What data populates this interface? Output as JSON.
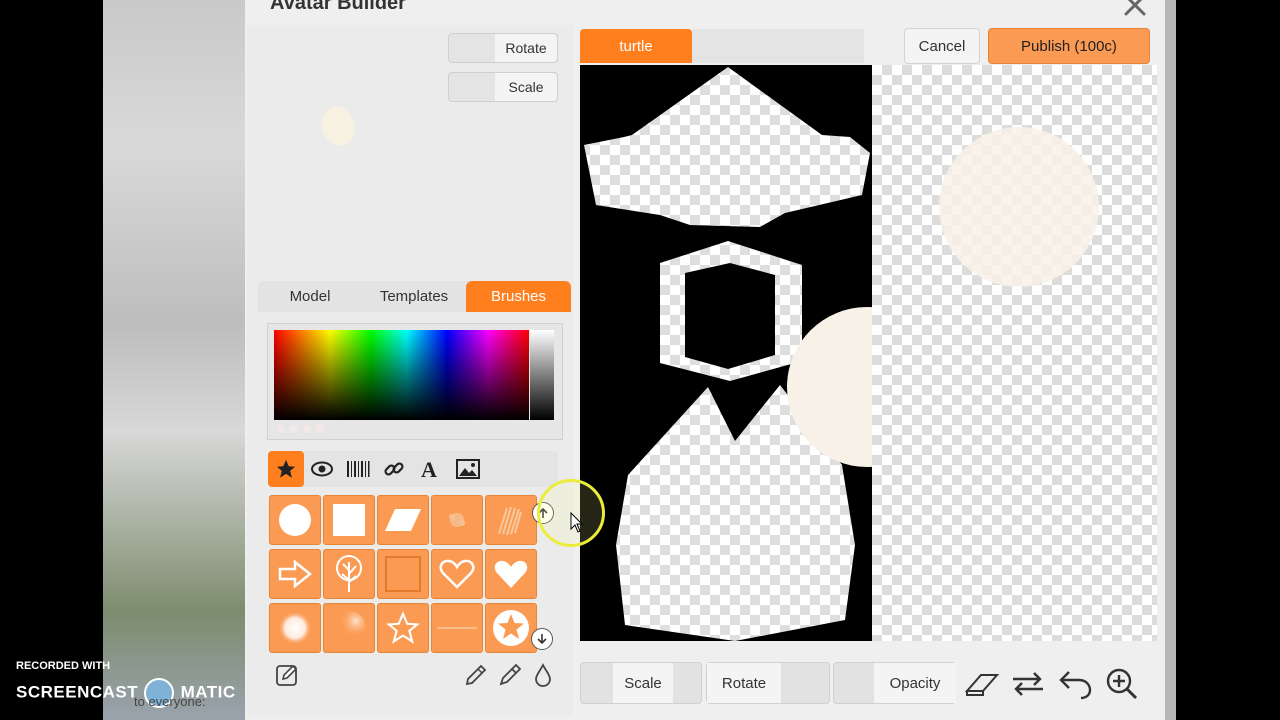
{
  "window": {
    "title": "Avatar Builder"
  },
  "left_tools": {
    "rotate_label": "Rotate",
    "scale_label": "Scale"
  },
  "tabs": [
    {
      "label": "Model"
    },
    {
      "label": "Templates"
    },
    {
      "label": "Brushes",
      "active": true
    }
  ],
  "category_icons": [
    "star-icon",
    "eye-icon",
    "barcode-icon",
    "link-icon",
    "text-icon",
    "image-icon"
  ],
  "brushes": [
    {
      "name": "circle-brush"
    },
    {
      "name": "square-brush"
    },
    {
      "name": "parallelogram-brush"
    },
    {
      "name": "splatter-brush"
    },
    {
      "name": "scribble-brush"
    },
    {
      "name": "arrow-brush"
    },
    {
      "name": "tree-brush"
    },
    {
      "name": "outline-square-brush"
    },
    {
      "name": "outline-heart-brush"
    },
    {
      "name": "heart-brush"
    },
    {
      "name": "soft-circle-brush"
    },
    {
      "name": "gradient-brush"
    },
    {
      "name": "outline-star-brush"
    },
    {
      "name": "line-brush"
    },
    {
      "name": "star-badge-brush"
    }
  ],
  "layer": {
    "name": "turtle"
  },
  "header_buttons": {
    "cancel": "Cancel",
    "publish": "Publish (100c)"
  },
  "bottom_toolbar": {
    "scale": "Scale",
    "rotate": "Rotate",
    "opacity": "Opacity"
  },
  "colors": {
    "accent": "#ff7f1f",
    "paint": "#f8f1e8",
    "panel": "#efefef"
  },
  "watermark": {
    "line1": "RECORDED WITH",
    "line2": "SCREENCAST",
    "line3": "MATIC"
  },
  "chat_text": "to everyone:"
}
